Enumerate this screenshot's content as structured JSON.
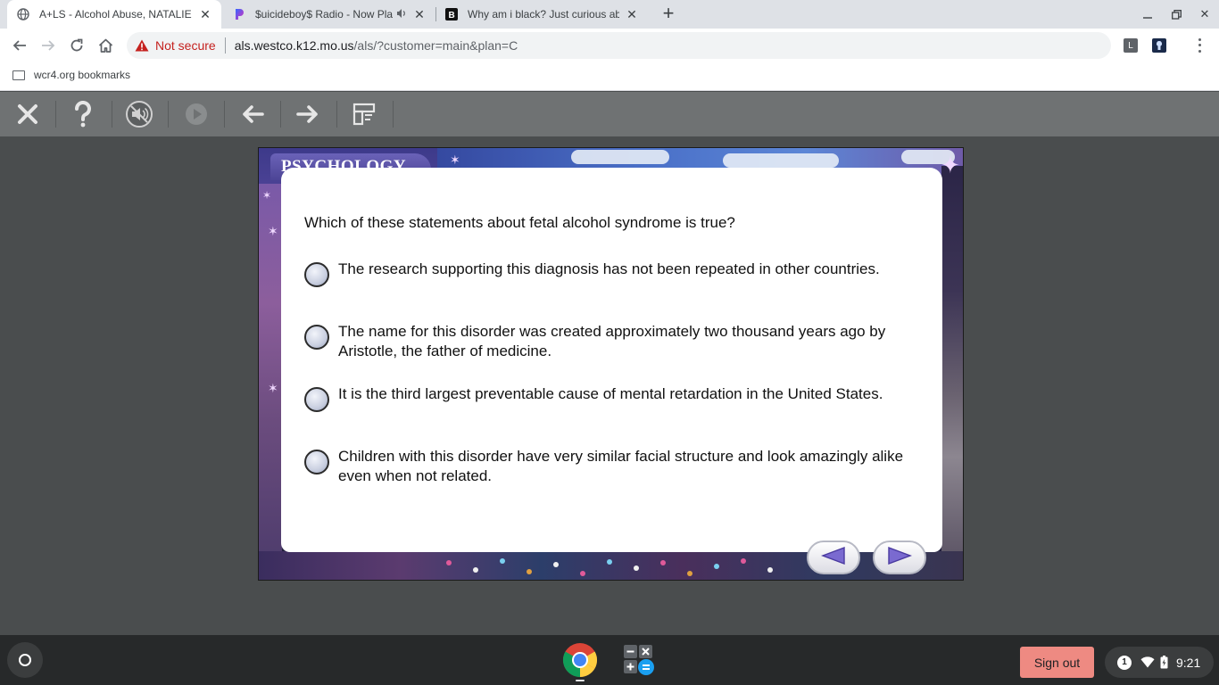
{
  "browser": {
    "tabs": [
      {
        "title": "A+LS - Alcohol Abuse, NATALIE H",
        "active": true,
        "favicon": "globe-icon"
      },
      {
        "title": "$uicideboy$ Radio - Now Pla",
        "active": false,
        "favicon": "pandora-icon",
        "audio": true
      },
      {
        "title": "Why am i black? Just curious ab",
        "active": false,
        "favicon": "brainly-icon"
      }
    ],
    "new_tab_icon": "plus-icon",
    "security_label": "Not secure",
    "url_host": "als.westco.k12.mo.us",
    "url_path": "/als/?customer=main&plan=C",
    "extensions": [
      {
        "label": "L",
        "color": "#5f6368"
      },
      {
        "label": "",
        "color": "#1a2a4a"
      }
    ],
    "bookmarks": [
      {
        "label": "wcr4.org bookmarks",
        "icon": "folder-icon"
      }
    ]
  },
  "app_toolbar": {
    "buttons": [
      {
        "name": "close",
        "icon": "close-icon"
      },
      {
        "name": "help",
        "icon": "help-icon"
      },
      {
        "name": "audio",
        "icon": "speaker-muted-icon"
      },
      {
        "name": "play",
        "icon": "play-icon",
        "disabled": true
      },
      {
        "name": "back",
        "icon": "arrow-left-icon"
      },
      {
        "name": "forward",
        "icon": "arrow-right-icon"
      },
      {
        "name": "glossary",
        "icon": "glossary-icon"
      }
    ]
  },
  "lesson": {
    "subject": "PSYCHOLOGY",
    "question": "Which of these statements about fetal alcohol syndrome is true?",
    "options": [
      {
        "text": "The research supporting this diagnosis has not been repeated in other countries.",
        "selected": false
      },
      {
        "text": "The name for this disorder was created approximately two thousand years ago by Aristotle, the father of medicine.",
        "selected": false
      },
      {
        "text": "It is the third largest preventable cause of mental retardation in the United States.",
        "selected": false
      },
      {
        "text": "Children with this disorder have very similar facial structure and look amazingly alike even when not related.",
        "selected": false
      }
    ],
    "prev_icon": "triangle-left-icon",
    "next_icon": "triangle-right-icon"
  },
  "shelf": {
    "apps": [
      {
        "name": "chrome",
        "icon": "chrome-icon",
        "running": true
      },
      {
        "name": "calculator",
        "icon": "calculator-icon",
        "running": false
      }
    ],
    "sign_out_label": "Sign out",
    "notification_count": "1",
    "time": "9:21"
  },
  "colors": {
    "app_toolbar_bg": "#6f7273",
    "page_bg": "#4a4d4e",
    "sign_out_bg": "#ee8a82",
    "radio_fill": "#c9cfe0"
  }
}
